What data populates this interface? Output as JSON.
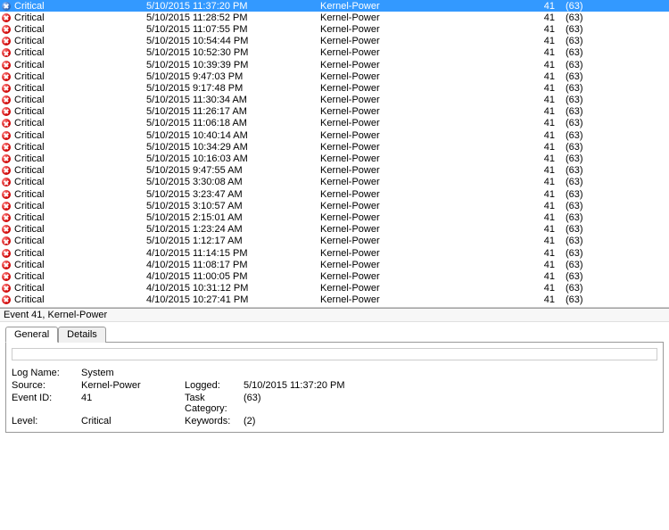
{
  "events": [
    {
      "level": "Critical",
      "date": "5/10/2015 11:37:20 PM",
      "source": "Kernel-Power",
      "id": "41",
      "cat": "(63)",
      "selected": true
    },
    {
      "level": "Critical",
      "date": "5/10/2015 11:28:52 PM",
      "source": "Kernel-Power",
      "id": "41",
      "cat": "(63)"
    },
    {
      "level": "Critical",
      "date": "5/10/2015 11:07:55 PM",
      "source": "Kernel-Power",
      "id": "41",
      "cat": "(63)"
    },
    {
      "level": "Critical",
      "date": "5/10/2015 10:54:44 PM",
      "source": "Kernel-Power",
      "id": "41",
      "cat": "(63)"
    },
    {
      "level": "Critical",
      "date": "5/10/2015 10:52:30 PM",
      "source": "Kernel-Power",
      "id": "41",
      "cat": "(63)"
    },
    {
      "level": "Critical",
      "date": "5/10/2015 10:39:39 PM",
      "source": "Kernel-Power",
      "id": "41",
      "cat": "(63)"
    },
    {
      "level": "Critical",
      "date": "5/10/2015 9:47:03 PM",
      "source": "Kernel-Power",
      "id": "41",
      "cat": "(63)"
    },
    {
      "level": "Critical",
      "date": "5/10/2015 9:17:48 PM",
      "source": "Kernel-Power",
      "id": "41",
      "cat": "(63)"
    },
    {
      "level": "Critical",
      "date": "5/10/2015 11:30:34 AM",
      "source": "Kernel-Power",
      "id": "41",
      "cat": "(63)"
    },
    {
      "level": "Critical",
      "date": "5/10/2015 11:26:17 AM",
      "source": "Kernel-Power",
      "id": "41",
      "cat": "(63)"
    },
    {
      "level": "Critical",
      "date": "5/10/2015 11:06:18 AM",
      "source": "Kernel-Power",
      "id": "41",
      "cat": "(63)"
    },
    {
      "level": "Critical",
      "date": "5/10/2015 10:40:14 AM",
      "source": "Kernel-Power",
      "id": "41",
      "cat": "(63)"
    },
    {
      "level": "Critical",
      "date": "5/10/2015 10:34:29 AM",
      "source": "Kernel-Power",
      "id": "41",
      "cat": "(63)"
    },
    {
      "level": "Critical",
      "date": "5/10/2015 10:16:03 AM",
      "source": "Kernel-Power",
      "id": "41",
      "cat": "(63)"
    },
    {
      "level": "Critical",
      "date": "5/10/2015 9:47:55 AM",
      "source": "Kernel-Power",
      "id": "41",
      "cat": "(63)"
    },
    {
      "level": "Critical",
      "date": "5/10/2015 3:30:08 AM",
      "source": "Kernel-Power",
      "id": "41",
      "cat": "(63)"
    },
    {
      "level": "Critical",
      "date": "5/10/2015 3:23:47 AM",
      "source": "Kernel-Power",
      "id": "41",
      "cat": "(63)"
    },
    {
      "level": "Critical",
      "date": "5/10/2015 3:10:57 AM",
      "source": "Kernel-Power",
      "id": "41",
      "cat": "(63)"
    },
    {
      "level": "Critical",
      "date": "5/10/2015 2:15:01 AM",
      "source": "Kernel-Power",
      "id": "41",
      "cat": "(63)"
    },
    {
      "level": "Critical",
      "date": "5/10/2015 1:23:24 AM",
      "source": "Kernel-Power",
      "id": "41",
      "cat": "(63)"
    },
    {
      "level": "Critical",
      "date": "5/10/2015 1:12:17 AM",
      "source": "Kernel-Power",
      "id": "41",
      "cat": "(63)"
    },
    {
      "level": "Critical",
      "date": "4/10/2015 11:14:15 PM",
      "source": "Kernel-Power",
      "id": "41",
      "cat": "(63)"
    },
    {
      "level": "Critical",
      "date": "4/10/2015 11:08:17 PM",
      "source": "Kernel-Power",
      "id": "41",
      "cat": "(63)"
    },
    {
      "level": "Critical",
      "date": "4/10/2015 11:00:05 PM",
      "source": "Kernel-Power",
      "id": "41",
      "cat": "(63)"
    },
    {
      "level": "Critical",
      "date": "4/10/2015 10:31:12 PM",
      "source": "Kernel-Power",
      "id": "41",
      "cat": "(63)"
    },
    {
      "level": "Critical",
      "date": "4/10/2015 10:27:41 PM",
      "source": "Kernel-Power",
      "id": "41",
      "cat": "(63)"
    }
  ],
  "detail": {
    "title": "Event 41, Kernel-Power",
    "tabs": {
      "general": "General",
      "details": "Details"
    },
    "labels": {
      "logname": "Log Name:",
      "source": "Source:",
      "eventid": "Event ID:",
      "level": "Level:",
      "logged": "Logged:",
      "taskcat": "Task Category:",
      "keywords": "Keywords:"
    },
    "values": {
      "logname": "System",
      "source": "Kernel-Power",
      "eventid": "41",
      "level": "Critical",
      "logged": "5/10/2015 11:37:20 PM",
      "taskcat": "(63)",
      "keywords": "(2)"
    }
  }
}
